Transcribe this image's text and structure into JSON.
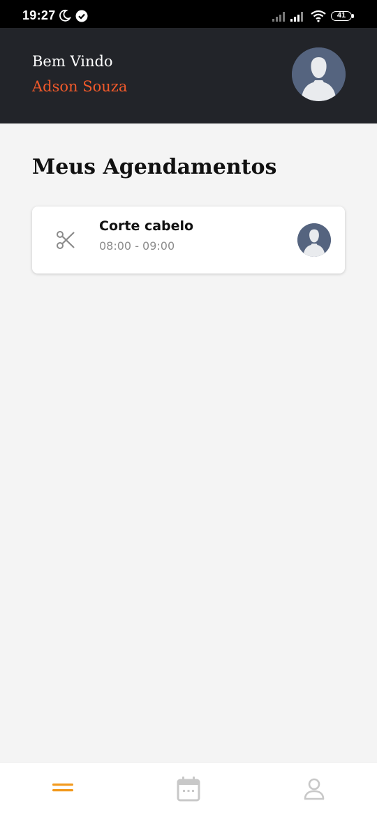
{
  "status_bar": {
    "time": "19:27",
    "battery": "41",
    "icons": [
      "moon-icon",
      "check-circle-icon",
      "signal-icon",
      "signal-icon",
      "wifi-icon",
      "battery-icon"
    ]
  },
  "header": {
    "welcome": "Bem Vindo",
    "user_name": "Adson Souza",
    "avatar_icon": "user-avatar-icon"
  },
  "main": {
    "title": "Meus Agendamentos",
    "appointments": [
      {
        "service": "Corte cabelo",
        "time": "08:00 - 09:00",
        "icon": "scissors-icon",
        "avatar_icon": "user-avatar-icon"
      }
    ]
  },
  "bottom_nav": {
    "items": [
      {
        "icon": "menu-icon",
        "active": true
      },
      {
        "icon": "calendar-icon",
        "active": false
      },
      {
        "icon": "profile-icon",
        "active": false
      }
    ]
  },
  "colors": {
    "header_bg": "#222429",
    "accent": "#f0592a",
    "nav_active": "#f29a1f",
    "nav_inactive": "#c8c8c8",
    "avatar_bg": "#55647f"
  }
}
